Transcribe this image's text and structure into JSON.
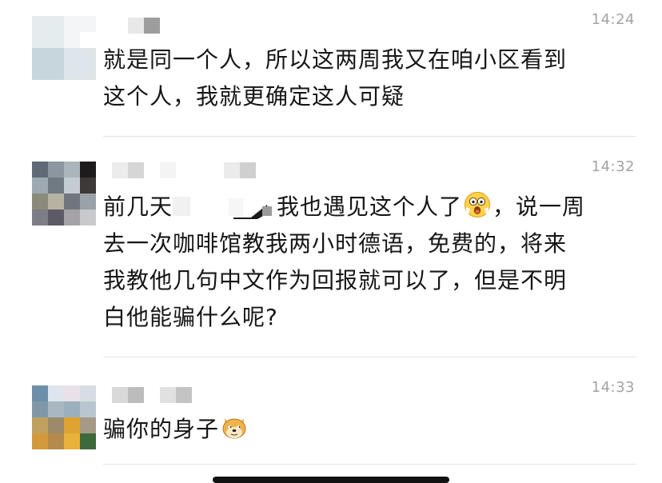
{
  "messages": [
    {
      "time": "14:24",
      "lines": [
        "就是同一个人，所以这两周我又在咱小区看到",
        "这个人，我就更确定这人可疑"
      ]
    },
    {
      "time": "14:32",
      "line1_prefix": "前几天",
      "line1_mid": "我也遇见这个人了",
      "line1_suffix": "，说一周",
      "lines_rest": [
        "去一次咖啡馆教我两小时德语，免费的，将来",
        "我教他几句中文作为回报就可以了，但是不明",
        "白他能骗什么呢?"
      ],
      "emoji": "shocked-face-emoji"
    },
    {
      "time": "14:33",
      "text": "骗你的身子",
      "emoji": "doge-emoji"
    }
  ],
  "colors": {
    "divider": "#e3e3e3",
    "timestamp": "#a3a3a3",
    "text": "#161616"
  }
}
